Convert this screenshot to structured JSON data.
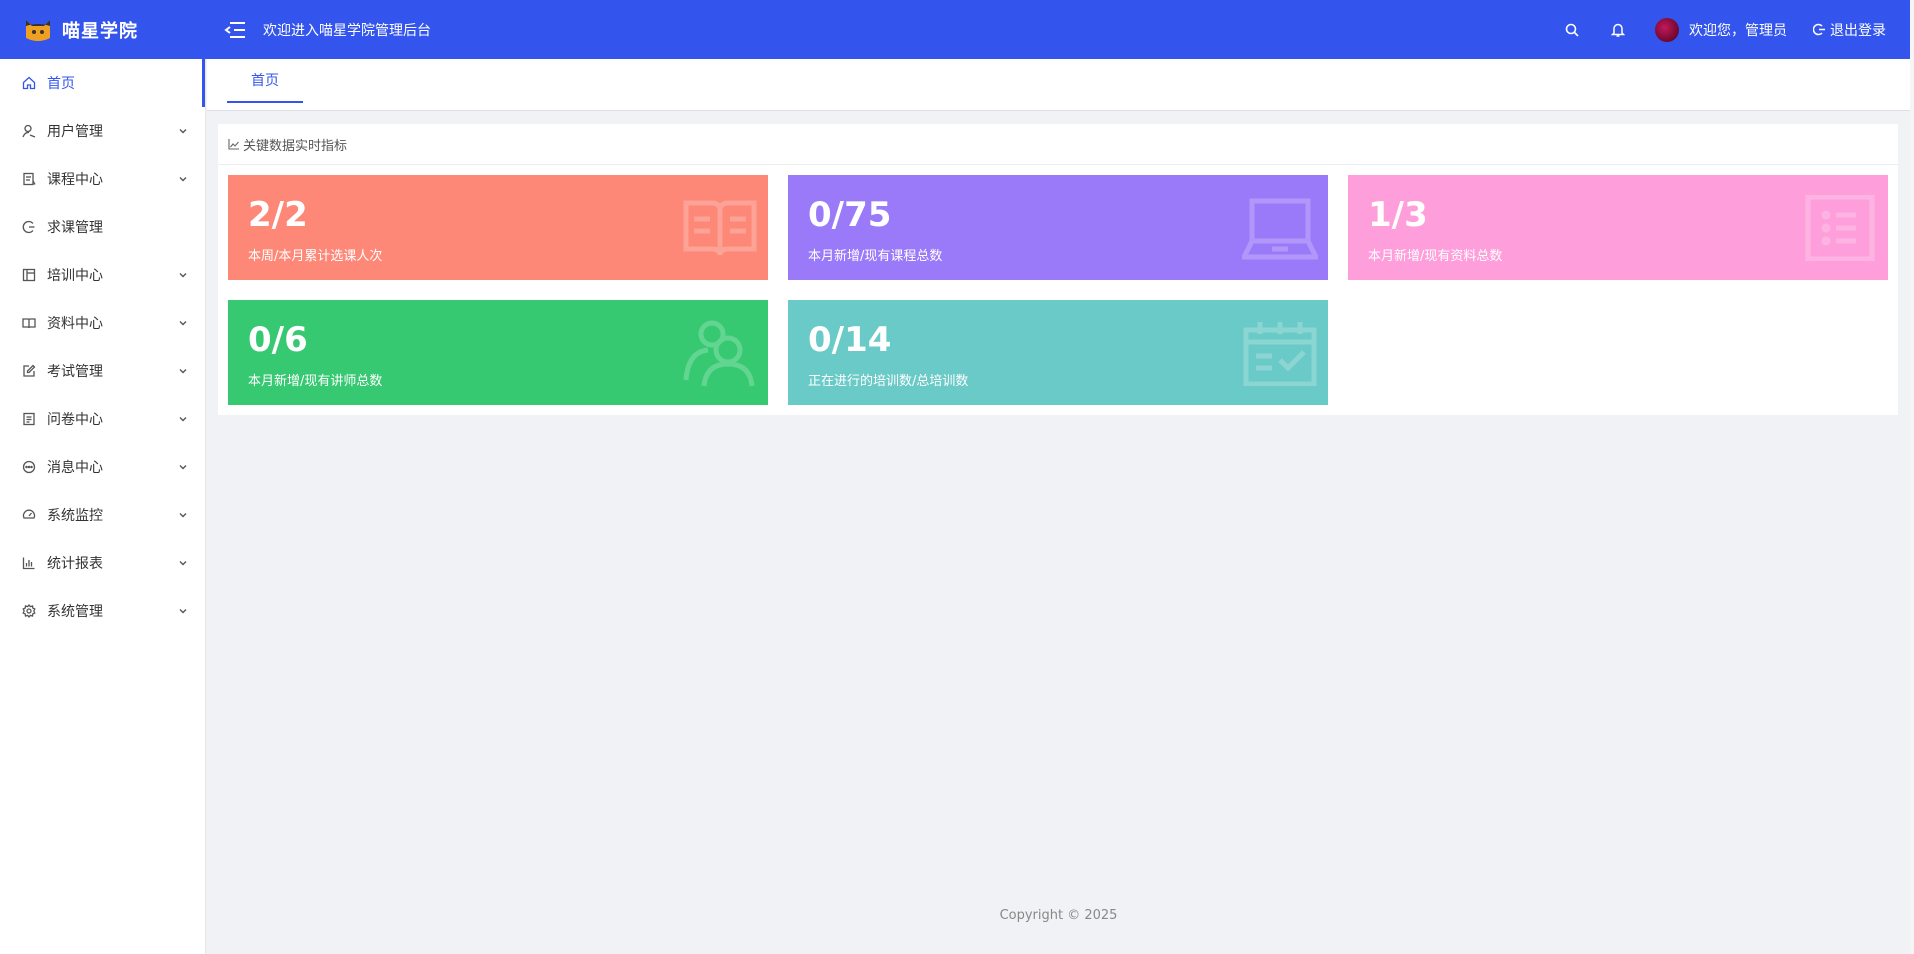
{
  "header": {
    "logo_text": "喵星学院",
    "welcome_title": "欢迎进入喵星学院管理后台",
    "user_greeting": "欢迎您，管理员",
    "logout_label": "退出登录",
    "brand_color": "#3355ee"
  },
  "sidebar": {
    "items": [
      {
        "label": "首页",
        "icon": "home-icon",
        "active": true
      },
      {
        "label": "用户管理",
        "icon": "user-icon"
      },
      {
        "label": "课程中心",
        "icon": "course-icon"
      },
      {
        "label": "求课管理",
        "icon": "request-icon"
      },
      {
        "label": "培训中心",
        "icon": "training-icon"
      },
      {
        "label": "资料中心",
        "icon": "book-icon"
      },
      {
        "label": "考试管理",
        "icon": "edit-icon"
      },
      {
        "label": "问卷中心",
        "icon": "survey-icon"
      },
      {
        "label": "消息中心",
        "icon": "message-icon"
      },
      {
        "label": "系统监控",
        "icon": "monitor-icon"
      },
      {
        "label": "统计报表",
        "icon": "chart-icon"
      },
      {
        "label": "系统管理",
        "icon": "gear-icon"
      }
    ]
  },
  "tabs": [
    {
      "label": "首页"
    }
  ],
  "panel": {
    "title": "关键数据实时指标",
    "cards": [
      {
        "value": "2/2",
        "desc": "本周/本月累计选课人次",
        "icon": "open-book-icon",
        "color": "#fd8878"
      },
      {
        "value": "0/75",
        "desc": "本月新增/现有课程总数",
        "icon": "laptop-icon",
        "color": "#9b7af9"
      },
      {
        "value": "1/3",
        "desc": "本月新增/现有资料总数",
        "icon": "list-document-icon",
        "color": "#fe9fdc"
      },
      {
        "value": "0/6",
        "desc": "本月新增/现有讲师总数",
        "icon": "users-icon",
        "color": "#36c972"
      },
      {
        "value": "0/14",
        "desc": "正在进行的培训数/总培训数",
        "icon": "calendar-check-icon",
        "color": "#6acac7"
      }
    ]
  },
  "footer": {
    "text": "Copyright © 2025"
  }
}
